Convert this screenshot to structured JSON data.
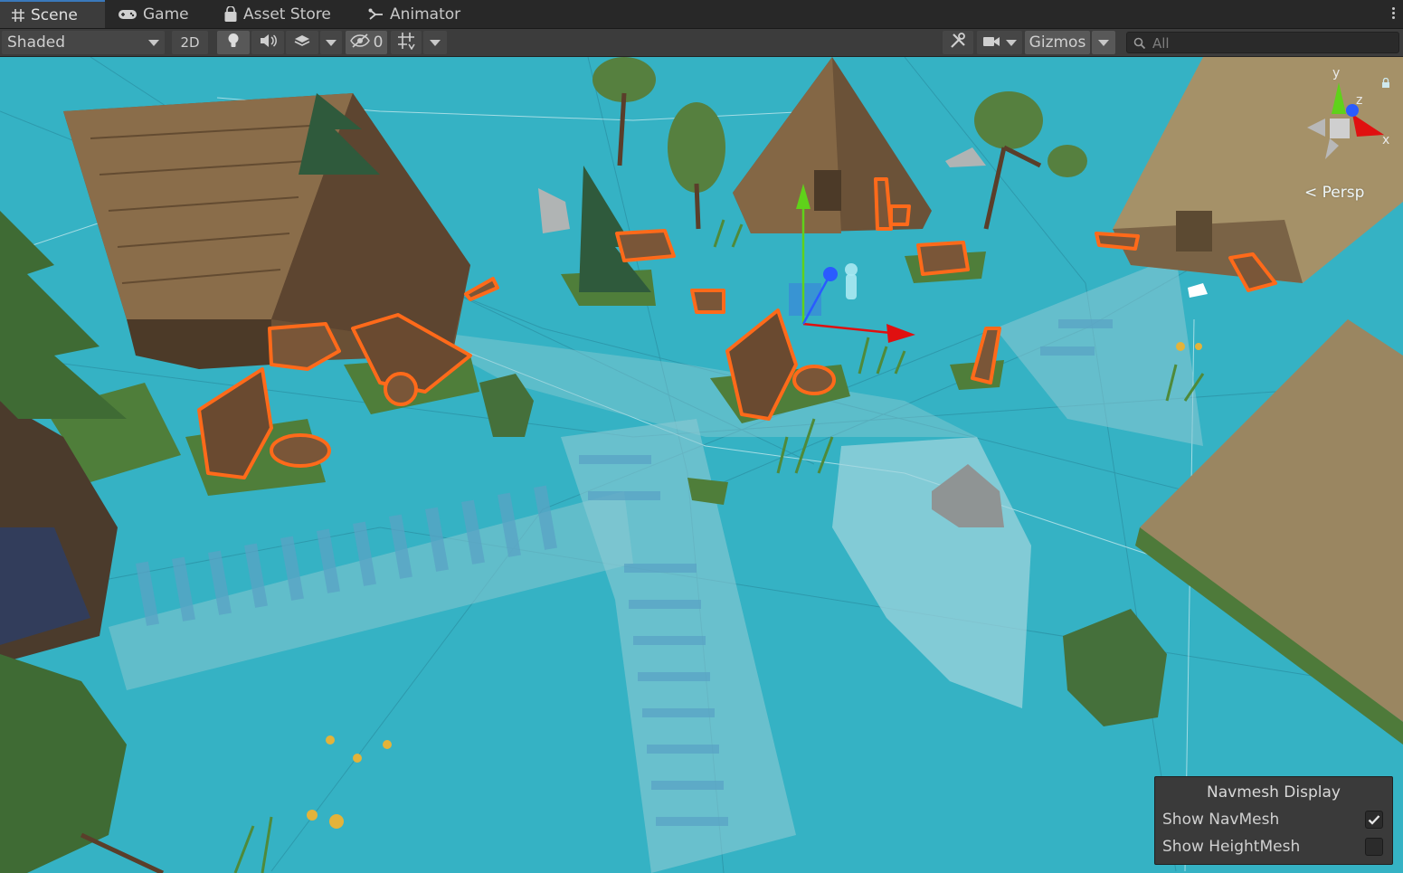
{
  "tabs": [
    {
      "label": "Scene",
      "icon": "grid-hash-icon",
      "active": true
    },
    {
      "label": "Game",
      "icon": "gamepad-icon",
      "active": false
    },
    {
      "label": "Asset Store",
      "icon": "shopping-bag-icon",
      "active": false
    },
    {
      "label": "Animator",
      "icon": "animator-icon",
      "active": false
    }
  ],
  "toolbar": {
    "draw_mode": "Shaded",
    "toggle_2d": "2D",
    "hidden_count": "0",
    "gizmos": "Gizmos",
    "search_placeholder": "All"
  },
  "scene_view": {
    "axis_labels": {
      "y": "y",
      "z": "z",
      "x": "x"
    },
    "projection": "Persp"
  },
  "navmesh_display": {
    "title": "Navmesh Display",
    "show_navmesh": {
      "label": "Show NavMesh",
      "checked": true
    },
    "show_heightmesh": {
      "label": "Show HeightMesh",
      "checked": false
    }
  },
  "colors": {
    "navmesh": "#34b0c2",
    "selection_outline": "#ff6a1a",
    "axis_x": "#e01010",
    "axis_y": "#5fd21a",
    "axis_z": "#2a5bff"
  }
}
